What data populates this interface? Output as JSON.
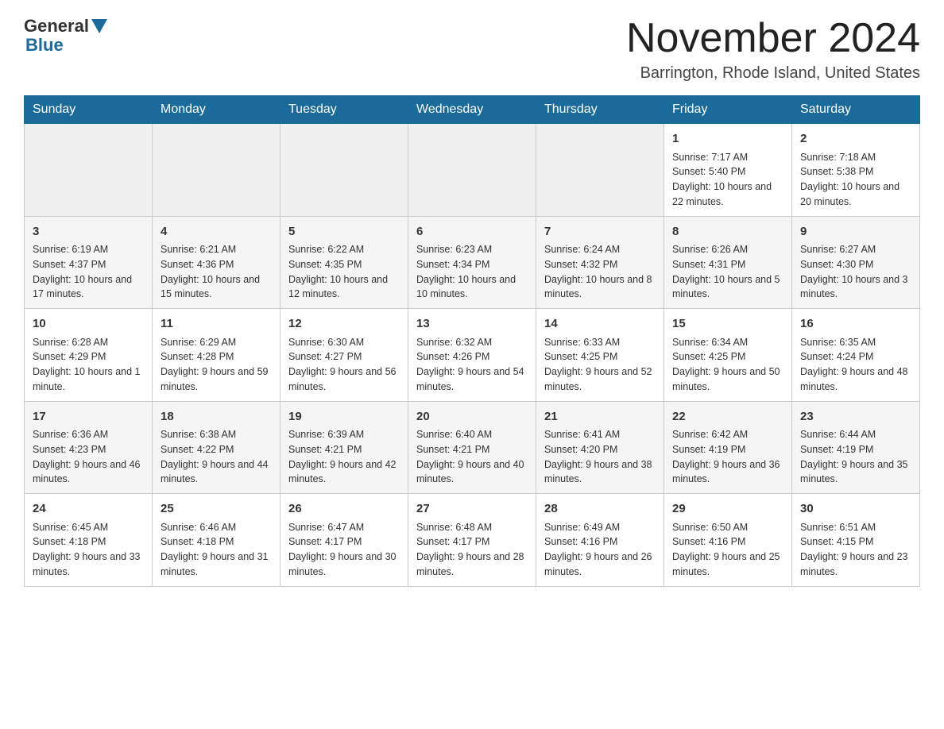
{
  "header": {
    "logo_general": "General",
    "logo_blue": "Blue",
    "month_title": "November 2024",
    "location": "Barrington, Rhode Island, United States"
  },
  "days_of_week": [
    "Sunday",
    "Monday",
    "Tuesday",
    "Wednesday",
    "Thursday",
    "Friday",
    "Saturday"
  ],
  "weeks": [
    [
      {
        "day": "",
        "info": ""
      },
      {
        "day": "",
        "info": ""
      },
      {
        "day": "",
        "info": ""
      },
      {
        "day": "",
        "info": ""
      },
      {
        "day": "",
        "info": ""
      },
      {
        "day": "1",
        "info": "Sunrise: 7:17 AM\nSunset: 5:40 PM\nDaylight: 10 hours and 22 minutes."
      },
      {
        "day": "2",
        "info": "Sunrise: 7:18 AM\nSunset: 5:38 PM\nDaylight: 10 hours and 20 minutes."
      }
    ],
    [
      {
        "day": "3",
        "info": "Sunrise: 6:19 AM\nSunset: 4:37 PM\nDaylight: 10 hours and 17 minutes."
      },
      {
        "day": "4",
        "info": "Sunrise: 6:21 AM\nSunset: 4:36 PM\nDaylight: 10 hours and 15 minutes."
      },
      {
        "day": "5",
        "info": "Sunrise: 6:22 AM\nSunset: 4:35 PM\nDaylight: 10 hours and 12 minutes."
      },
      {
        "day": "6",
        "info": "Sunrise: 6:23 AM\nSunset: 4:34 PM\nDaylight: 10 hours and 10 minutes."
      },
      {
        "day": "7",
        "info": "Sunrise: 6:24 AM\nSunset: 4:32 PM\nDaylight: 10 hours and 8 minutes."
      },
      {
        "day": "8",
        "info": "Sunrise: 6:26 AM\nSunset: 4:31 PM\nDaylight: 10 hours and 5 minutes."
      },
      {
        "day": "9",
        "info": "Sunrise: 6:27 AM\nSunset: 4:30 PM\nDaylight: 10 hours and 3 minutes."
      }
    ],
    [
      {
        "day": "10",
        "info": "Sunrise: 6:28 AM\nSunset: 4:29 PM\nDaylight: 10 hours and 1 minute."
      },
      {
        "day": "11",
        "info": "Sunrise: 6:29 AM\nSunset: 4:28 PM\nDaylight: 9 hours and 59 minutes."
      },
      {
        "day": "12",
        "info": "Sunrise: 6:30 AM\nSunset: 4:27 PM\nDaylight: 9 hours and 56 minutes."
      },
      {
        "day": "13",
        "info": "Sunrise: 6:32 AM\nSunset: 4:26 PM\nDaylight: 9 hours and 54 minutes."
      },
      {
        "day": "14",
        "info": "Sunrise: 6:33 AM\nSunset: 4:25 PM\nDaylight: 9 hours and 52 minutes."
      },
      {
        "day": "15",
        "info": "Sunrise: 6:34 AM\nSunset: 4:25 PM\nDaylight: 9 hours and 50 minutes."
      },
      {
        "day": "16",
        "info": "Sunrise: 6:35 AM\nSunset: 4:24 PM\nDaylight: 9 hours and 48 minutes."
      }
    ],
    [
      {
        "day": "17",
        "info": "Sunrise: 6:36 AM\nSunset: 4:23 PM\nDaylight: 9 hours and 46 minutes."
      },
      {
        "day": "18",
        "info": "Sunrise: 6:38 AM\nSunset: 4:22 PM\nDaylight: 9 hours and 44 minutes."
      },
      {
        "day": "19",
        "info": "Sunrise: 6:39 AM\nSunset: 4:21 PM\nDaylight: 9 hours and 42 minutes."
      },
      {
        "day": "20",
        "info": "Sunrise: 6:40 AM\nSunset: 4:21 PM\nDaylight: 9 hours and 40 minutes."
      },
      {
        "day": "21",
        "info": "Sunrise: 6:41 AM\nSunset: 4:20 PM\nDaylight: 9 hours and 38 minutes."
      },
      {
        "day": "22",
        "info": "Sunrise: 6:42 AM\nSunset: 4:19 PM\nDaylight: 9 hours and 36 minutes."
      },
      {
        "day": "23",
        "info": "Sunrise: 6:44 AM\nSunset: 4:19 PM\nDaylight: 9 hours and 35 minutes."
      }
    ],
    [
      {
        "day": "24",
        "info": "Sunrise: 6:45 AM\nSunset: 4:18 PM\nDaylight: 9 hours and 33 minutes."
      },
      {
        "day": "25",
        "info": "Sunrise: 6:46 AM\nSunset: 4:18 PM\nDaylight: 9 hours and 31 minutes."
      },
      {
        "day": "26",
        "info": "Sunrise: 6:47 AM\nSunset: 4:17 PM\nDaylight: 9 hours and 30 minutes."
      },
      {
        "day": "27",
        "info": "Sunrise: 6:48 AM\nSunset: 4:17 PM\nDaylight: 9 hours and 28 minutes."
      },
      {
        "day": "28",
        "info": "Sunrise: 6:49 AM\nSunset: 4:16 PM\nDaylight: 9 hours and 26 minutes."
      },
      {
        "day": "29",
        "info": "Sunrise: 6:50 AM\nSunset: 4:16 PM\nDaylight: 9 hours and 25 minutes."
      },
      {
        "day": "30",
        "info": "Sunrise: 6:51 AM\nSunset: 4:15 PM\nDaylight: 9 hours and 23 minutes."
      }
    ]
  ]
}
